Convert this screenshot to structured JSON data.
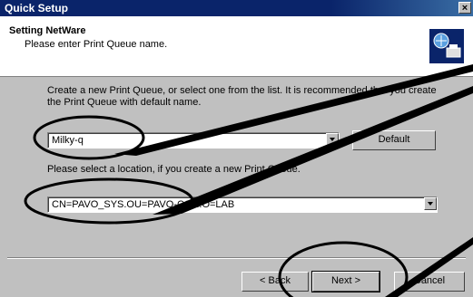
{
  "window": {
    "title": "Quick Setup",
    "close_glyph": "×"
  },
  "header": {
    "title": "Setting NetWare",
    "subtitle": "Please enter Print Queue name."
  },
  "main": {
    "instruction": "Create a new Print Queue, or select one from the list. It is recommended that you create the Print Queue with default name.",
    "queue_value": "Milky-q",
    "default_label": "Default",
    "location_prompt": "Please select a location, if you create a new Print Queue.",
    "location_value": "CN=PAVO_SYS.OU=PAVO-CON.O=LAB"
  },
  "footer": {
    "back_label": "< Back",
    "next_label": "Next >",
    "cancel_label": "Cancel"
  },
  "colors": {
    "titlebar": "#0a246a",
    "dialog": "#c0c0c0",
    "annotation": "#000000"
  }
}
